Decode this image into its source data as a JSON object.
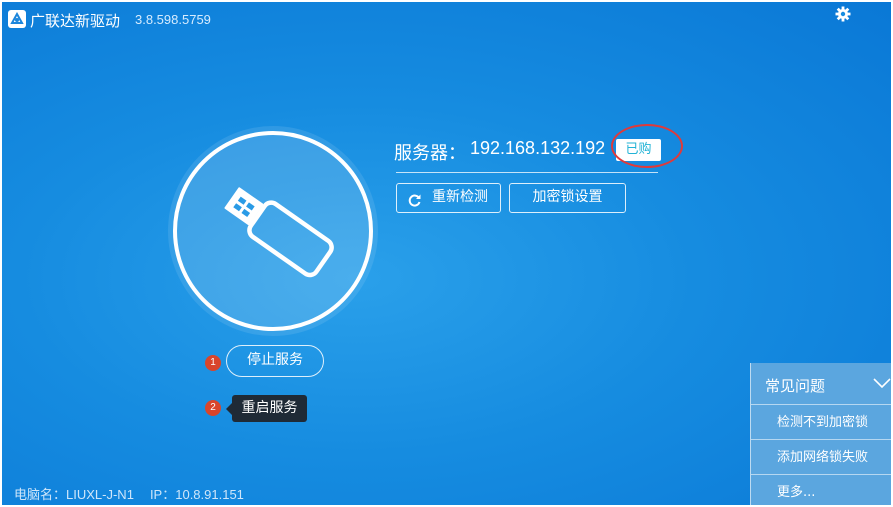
{
  "app": {
    "title": "广联达新驱动",
    "version": "3.8.598.5759",
    "logo_icon": "glodon-logo-icon",
    "settings_icon": "gear-icon"
  },
  "device": {
    "icon": "usb-drive-icon"
  },
  "service": {
    "stop_label": "停止服务",
    "restart_label": "重启服务",
    "badge_1": "1",
    "badge_2": "2"
  },
  "server": {
    "label": "服务器：",
    "ip": "192.168.132.192",
    "status": "已购"
  },
  "actions": {
    "recheck_label": "重新检测",
    "recheck_icon": "refresh-icon",
    "lock_settings_label": "加密锁设置"
  },
  "footer": {
    "pc_label": "电脑名：",
    "pc_value": "LIUXL-J-N1",
    "ip_label": "IP：",
    "ip_value": "10.8.91.151"
  },
  "faq": {
    "title": "常见问题",
    "items": [
      "检测不到加密锁",
      "添加网络锁失败",
      "更多..."
    ]
  },
  "colors": {
    "background": "#168ce0",
    "badge": "#d9452b",
    "annotation": "#e03a3a",
    "status_text": "#22b3d6",
    "tooltip": "#1f2a36"
  }
}
